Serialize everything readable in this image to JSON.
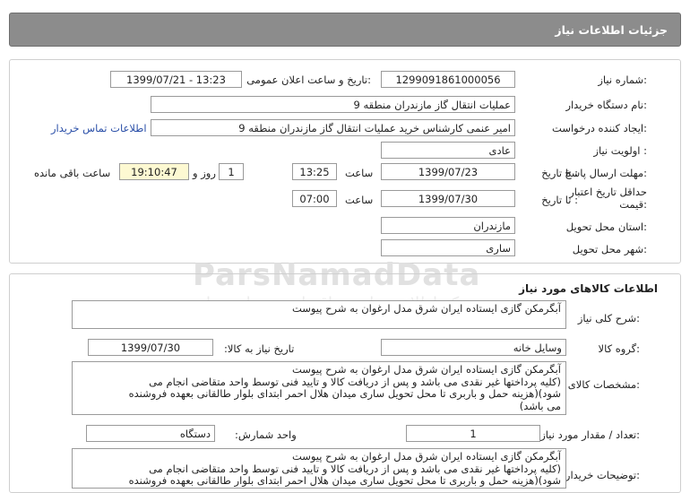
{
  "header": {
    "title": "جزئیات اطلاعات نیاز"
  },
  "details": {
    "need_number_label": "شماره نیاز:",
    "need_number": "1299091861000056",
    "announce_label": "تاریخ و ساعت اعلان عمومی:",
    "announce_value": "1399/07/21 - 13:23",
    "buyer_org_label": "نام دستگاه خریدار:",
    "buyer_org": "عملیات انتقال گاز مازندران منطقه 9",
    "requester_label": "ایجاد کننده درخواست:",
    "requester": "امیر عنمی کارشناس خرید عملیات انتقال گاز مازندران منطقه 9",
    "contact_link": "اطلاعات تماس خریدار",
    "priority_label": "اولویت نیاز :",
    "priority": "عادی",
    "deadline_label": "مهلت ارسال پاسخ:",
    "to_date_label": "تا تاریخ :",
    "deadline_date": "1399/07/23",
    "time_label": "ساعت",
    "deadline_time": "13:25",
    "days_value": "1",
    "days_label": "روز و",
    "remaining_time": "19:10:47",
    "remaining_label": "ساعت باقی مانده",
    "validity_label_1": "حداقل تاریخ اعتبار",
    "validity_label_2": "قیمت:",
    "validity_to_date_label": "تا تاریخ :",
    "validity_date": "1399/07/30",
    "validity_time_label": "ساعت",
    "validity_time": "07:00",
    "province_label": "استان محل تحویل:",
    "province": "مازندران",
    "city_label": "شهر محل تحویل:",
    "city": "ساری"
  },
  "watermark": {
    "main": "ParsNamadData",
    "sub": "مرکز اطلاع رسانی مناقصات و مزایده ها"
  },
  "goods": {
    "section_title": "اطلاعات کالاهای مورد نیاز",
    "general_desc_label": "شرح کلی نیاز:",
    "general_desc": "آبگرمکن گازی ایستاده ایران شرق مدل ارغوان به شرح پیوست",
    "group_label": "گروه کالا:",
    "group": "وسایل خانه",
    "need_date_label": "تاریخ نیاز به کالا:",
    "need_date": "1399/07/30",
    "spec_label": "مشخصات کالای مورد نیاز:",
    "spec_lines": [
      "آبگرمکن گازی ایستاده ایران شرق مدل ارغوان به شرح پیوست",
      "(کلیه پرداختها غیر نقدی می باشد و پس از دریافت کالا و تایید فنی توسط واحد متقاضی انجام می",
      "شود)(هزینه حمل و باربری تا محل تحویل ساری میدان هلال احمر ابتدای بلوار طالقانی بعهده فروشنده",
      "می باشد)"
    ],
    "count_label": "تعداد / مقدار مورد نیاز:",
    "count": "1",
    "unit_label": "واحد شمارش:",
    "unit": "دستگاه",
    "buyer_notes_label": "توضیحات خریدار:",
    "buyer_notes_lines": [
      "آبگرمکن گازی ایستاده ایران شرق مدل ارغوان به شرح پیوست",
      "(کلیه پرداختها غیر نقدی می باشد و پس از دریافت کالا و تایید فنی توسط واحد متقاضی انجام می",
      "شود)(هزینه حمل و باربری تا محل تحویل ساری میدان هلال احمر ابتدای بلوار طالقانی بعهده فروشنده"
    ]
  }
}
